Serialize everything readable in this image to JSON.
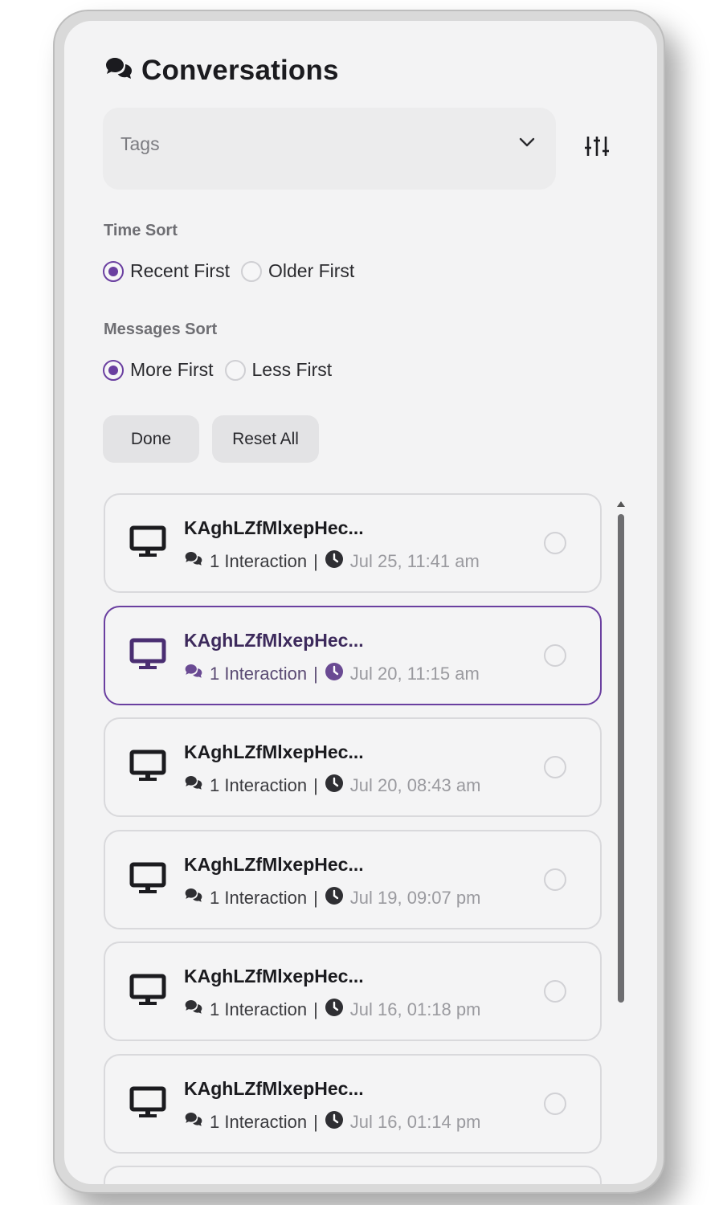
{
  "header": {
    "title": "Conversations",
    "icon": "chat-bubbles-icon"
  },
  "tags": {
    "placeholder": "Tags"
  },
  "time_sort": {
    "label": "Time Sort",
    "options": [
      {
        "label": "Recent First",
        "checked": true
      },
      {
        "label": "Older First",
        "checked": false
      }
    ]
  },
  "messages_sort": {
    "label": "Messages Sort",
    "options": [
      {
        "label": "More First",
        "checked": true
      },
      {
        "label": "Less First",
        "checked": false
      }
    ]
  },
  "actions": {
    "done": "Done",
    "reset": "Reset All"
  },
  "accent_color": "#6a3fa0",
  "conversations": [
    {
      "name": "KAghLZfMlxepHec...",
      "count": "1 Interaction",
      "sep": "|",
      "date": "Jul 25, 11:41 am",
      "selected": false
    },
    {
      "name": "KAghLZfMlxepHec...",
      "count": "1 Interaction",
      "sep": "|",
      "date": "Jul 20, 11:15 am",
      "selected": true
    },
    {
      "name": "KAghLZfMlxepHec...",
      "count": "1 Interaction",
      "sep": "|",
      "date": "Jul 20, 08:43 am",
      "selected": false
    },
    {
      "name": "KAghLZfMlxepHec...",
      "count": "1 Interaction",
      "sep": "|",
      "date": "Jul 19, 09:07 pm",
      "selected": false
    },
    {
      "name": "KAghLZfMlxepHec...",
      "count": "1 Interaction",
      "sep": "|",
      "date": "Jul 16, 01:18 pm",
      "selected": false
    },
    {
      "name": "KAghLZfMlxepHec...",
      "count": "1 Interaction",
      "sep": "|",
      "date": "Jul 16, 01:14 pm",
      "selected": false
    }
  ]
}
